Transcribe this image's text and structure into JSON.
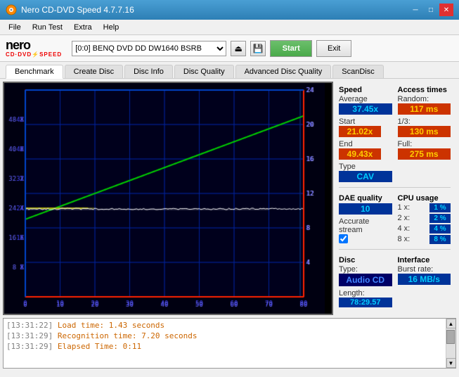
{
  "window": {
    "title": "Nero CD-DVD Speed 4.7.7.16"
  },
  "menu": {
    "items": [
      "File",
      "Run Test",
      "Extra",
      "Help"
    ]
  },
  "toolbar": {
    "drive_label": "[0:0]  BENQ DVD DD DW1640 BSRB",
    "start_label": "Start",
    "exit_label": "Exit"
  },
  "tabs": [
    {
      "label": "Benchmark",
      "active": true
    },
    {
      "label": "Create Disc",
      "active": false
    },
    {
      "label": "Disc Info",
      "active": false
    },
    {
      "label": "Disc Quality",
      "active": false
    },
    {
      "label": "Advanced Disc Quality",
      "active": false
    },
    {
      "label": "ScanDisc",
      "active": false
    }
  ],
  "stats": {
    "speed_label": "Speed",
    "average_label": "Average",
    "average_value": "37.45x",
    "start_label": "Start",
    "start_value": "21.02x",
    "end_label": "End",
    "end_value": "49.43x",
    "type_label": "Type",
    "type_value": "CAV",
    "access_times_label": "Access times",
    "random_label": "Random:",
    "random_value": "117 ms",
    "one_third_label": "1/3:",
    "one_third_value": "130 ms",
    "full_label": "Full:",
    "full_value": "275 ms",
    "cpu_usage_label": "CPU usage",
    "cpu_1x_label": "1 x:",
    "cpu_1x_value": "1 %",
    "cpu_2x_label": "2 x:",
    "cpu_2x_value": "2 %",
    "cpu_4x_label": "4 x:",
    "cpu_4x_value": "4 %",
    "cpu_8x_label": "8 x:",
    "cpu_8x_value": "8 %",
    "dae_quality_label": "DAE quality",
    "dae_quality_value": "10",
    "accurate_stream_label": "Accurate stream",
    "disc_label": "Disc",
    "disc_type_label": "Type:",
    "disc_type_value": "Audio CD",
    "disc_length_label": "Length:",
    "disc_length_value": "78:29.57",
    "interface_label": "Interface",
    "burst_rate_label": "Burst rate:",
    "burst_rate_value": "16 MB/s"
  },
  "log": {
    "entries": [
      {
        "time": "[13:31:22]",
        "text": "Load time: 1.43 seconds"
      },
      {
        "time": "[13:31:29]",
        "text": "Recognition time: 7.20 seconds"
      },
      {
        "time": "[13:31:29]",
        "text": "Elapsed Time: 0:11"
      }
    ]
  },
  "chart": {
    "x_max": 80,
    "y_max": 24,
    "y_right_labels": [
      24,
      20,
      16,
      12,
      8,
      4
    ],
    "x_labels": [
      0,
      10,
      20,
      30,
      40,
      50,
      60,
      70,
      80
    ]
  }
}
